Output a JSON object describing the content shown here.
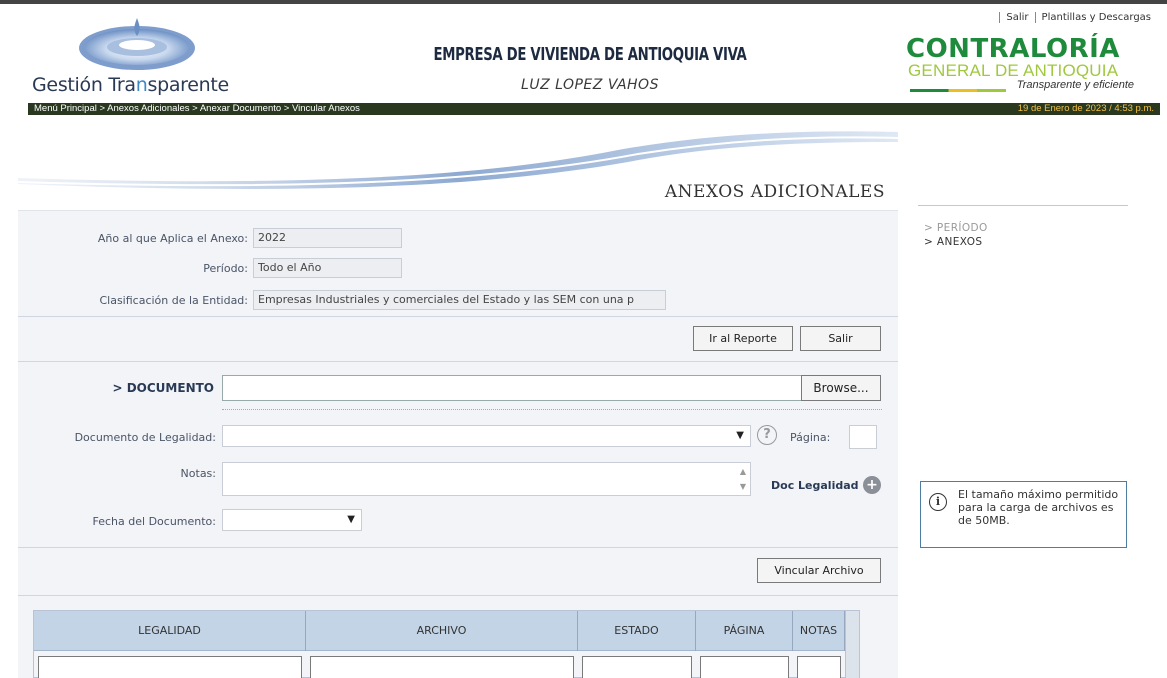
{
  "top_links": [
    "Salir",
    "Plantillas y Descargas"
  ],
  "header": {
    "logo_text_a": "Gestión Tra",
    "logo_text_b": "n",
    "logo_text_c": "sparente",
    "company": "EMPRESA DE VIVIENDA DE ANTIOQUIA VIVA",
    "user": "LUZ LOPEZ VAHOS",
    "contraloria": "CONTRALORÍA",
    "contraloria_sub": "GENERAL DE ANTIOQUIA",
    "contraloria_tag": "Transparente y eficiente"
  },
  "nav": {
    "breadcrumb": "Menú Principal   > Anexos Adicionales   > Anexar Documento   > Vincular Anexos",
    "date": "19 de Enero de 2023 / 4:53 p.m."
  },
  "panel": {
    "title": "ANEXOS ADICIONALES",
    "year_label": "Año al que Aplica el Anexo:",
    "year_value": "2022",
    "period_label": "Período:",
    "period_value": "Todo el Año",
    "class_label": "Clasificación de la Entidad:",
    "class_value": "Empresas Industriales y comerciales del Estado y las SEM con una p",
    "report_button": "Ir al Reporte",
    "exit_button": "Salir",
    "document_label": "> DOCUMENTO",
    "browse_button": "Browse...",
    "legal_doc_label": "Documento de Legalidad:",
    "page_label": "Página:",
    "notes_label": "Notas:",
    "doc_legalidad_link": "Doc Legalidad",
    "date_label": "Fecha del Documento:",
    "link_button": "Vincular Archivo"
  },
  "table": {
    "columns": [
      "LEGALIDAD",
      "ARCHIVO",
      "ESTADO",
      "PÁGINA",
      "NOTAS"
    ]
  },
  "side": {
    "items": [
      "> PERÍODO",
      "> ANEXOS"
    ],
    "info": "El tamaño máximo permitido para la carga de archivos es de 50MB."
  },
  "colors": {
    "nav_bg": "#2a3820",
    "date_text": "#f4c040",
    "panel_bg": "#f2f4f8",
    "table_header": "#c2d4e6",
    "contraloria_green": "#1e8a3c",
    "contraloria_lime": "#9fc83f"
  }
}
